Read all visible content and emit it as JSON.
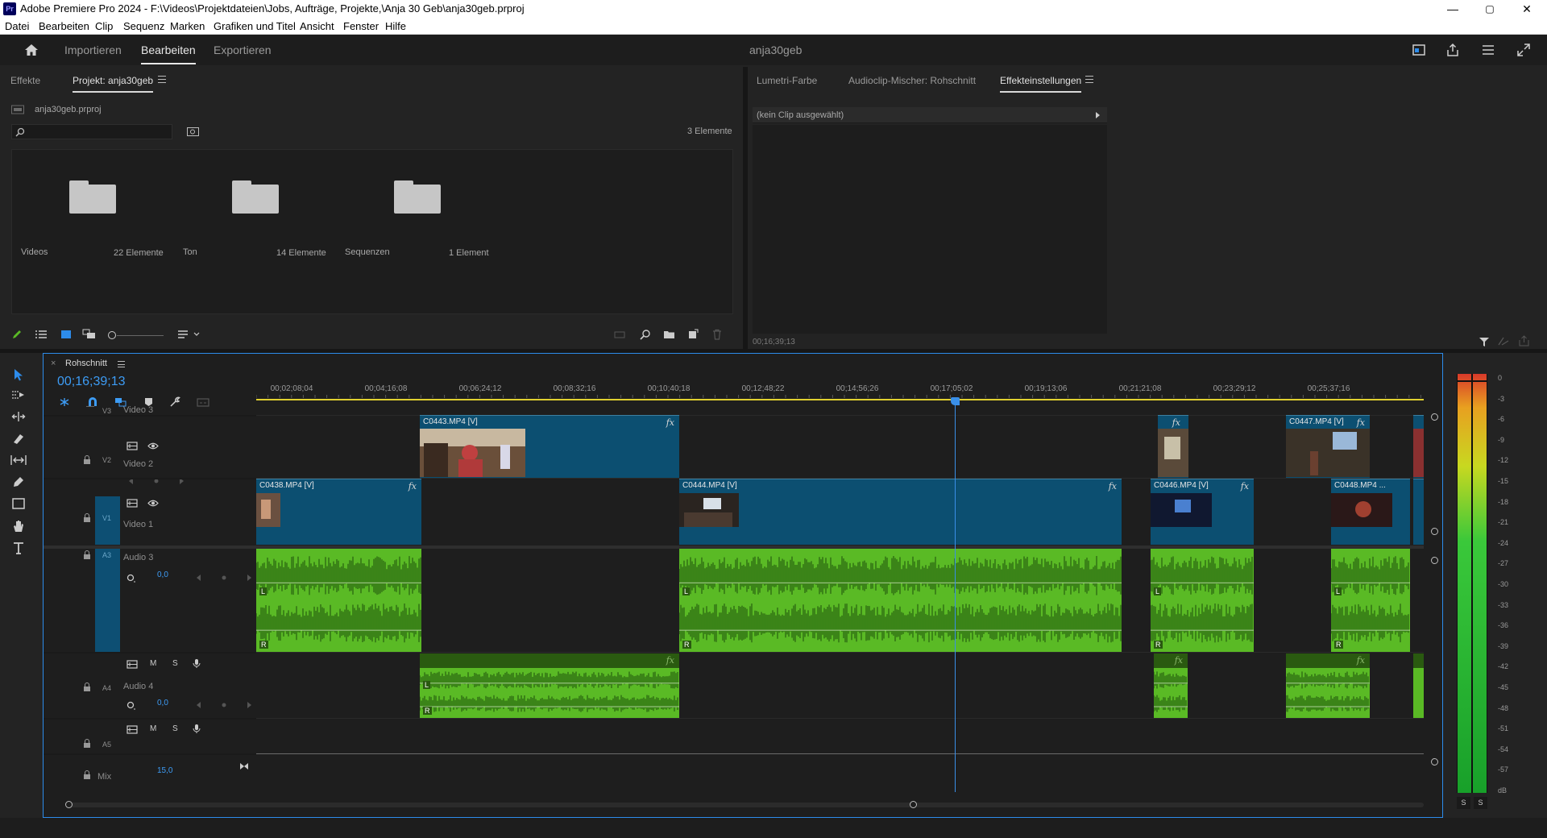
{
  "window": {
    "app_icon": "Pr",
    "title": "Adobe Premiere Pro 2024 - F:\\Videos\\Projektdateien\\Jobs, Aufträge, Projekte,\\Anja 30 Geb\\anja30geb.prproj",
    "min": "—",
    "max": "▢",
    "close": "✕"
  },
  "menu": [
    "Datei",
    "Bearbeiten",
    "Clip",
    "Sequenz",
    "Marken",
    "Grafiken und Titel",
    "Ansicht",
    "Fenster",
    "Hilfe"
  ],
  "header": {
    "tabs": [
      "Importieren",
      "Bearbeiten",
      "Exportieren"
    ],
    "active_tab": "Bearbeiten",
    "project_name": "anja30geb"
  },
  "project_panel": {
    "tabs": [
      "Effekte",
      "Projekt: anja30geb"
    ],
    "file": "anja30geb.prproj",
    "search_placeholder": "",
    "count": "3 Elemente",
    "bins": [
      {
        "name": "Videos",
        "count": "22 Elemente"
      },
      {
        "name": "Ton",
        "count": "14 Elemente"
      },
      {
        "name": "Sequenzen",
        "count": "1 Element"
      }
    ]
  },
  "effects_panel": {
    "tabs": [
      "Lumetri-Farbe",
      "Audioclip-Mischer: Rohschnitt",
      "Effekteinstellungen"
    ],
    "no_clip": "(kein Clip ausgewählt)",
    "timecode": "00;16;39;13"
  },
  "timeline": {
    "sequence": "Rohschnitt",
    "timecode": "00;16;39;13",
    "ruler": [
      "00;02;08;04",
      "00;04;16;08",
      "00;06;24;12",
      "00;08;32;16",
      "00;10;40;18",
      "00;12;48;22",
      "00;14;56;26",
      "00;17;05;02",
      "00;19;13;06",
      "00;21;21;08",
      "00;23;29;12",
      "00;25;37;16"
    ],
    "playhead_fraction": 0.598,
    "tracks": {
      "v3": {
        "id": "V3",
        "name": "Video 3"
      },
      "v2": {
        "id": "V2",
        "name": "Video 2"
      },
      "v1": {
        "id": "V1",
        "name": "Video 1"
      },
      "a3": {
        "id": "A3",
        "name": "Audio 3",
        "vol": "0,0"
      },
      "a4": {
        "id": "A4",
        "name": "Audio 4",
        "vol": "0,0"
      },
      "a5": {
        "id": "A5"
      },
      "mix": {
        "name": "Mix",
        "vol": "15,0"
      }
    },
    "btn_m": "M",
    "btn_s": "S",
    "clips": {
      "c0443": "C0443.MP4 [V]",
      "c0447": "C0447.MP4 [V]",
      "c0438": "C0438.MP4 [V]",
      "c0444": "C0444.MP4 [V]",
      "c0446": "C0446.MP4 [V]",
      "c0448": "C0448.MP4 ..."
    },
    "fx": "fx",
    "ch_l": "L",
    "ch_r": "R"
  },
  "meter": {
    "scale": [
      "0",
      "-3",
      "-6",
      "-9",
      "-12",
      "-15",
      "-18",
      "-21",
      "-24",
      "-27",
      "-30",
      "-33",
      "-36",
      "-39",
      "-42",
      "-45",
      "-48",
      "-51",
      "-54",
      "-57",
      "dB"
    ],
    "solo": [
      "S",
      "S"
    ]
  },
  "colors": {
    "accent": "#2d8ceb",
    "video_clip": "#0c4f71",
    "audio_clip": "#5aba25",
    "playhead": "#3a8fe8"
  }
}
